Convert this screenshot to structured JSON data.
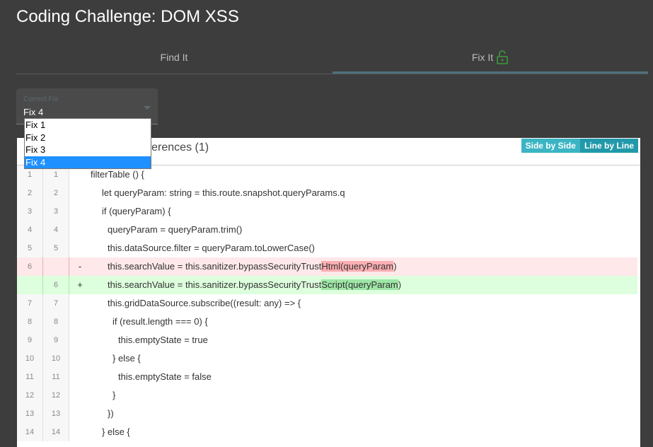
{
  "title": "Coding Challenge: DOM XSS",
  "tabs": [
    {
      "label": "Find It"
    },
    {
      "label": "Fix It"
    }
  ],
  "fix_select": {
    "label": "Correct Fix",
    "value": "Fix 4",
    "options": [
      "Fix 1",
      "Fix 2",
      "Fix 3",
      "Fix 4"
    ]
  },
  "diff": {
    "files_label": "ifferences (1)",
    "view_side_by_side": "Side by Side",
    "view_line_by_line": "Line by Line",
    "rows": [
      {
        "a": "1",
        "b": "1",
        "sign": "",
        "text": "filterTable () {",
        "type": "ctx",
        "indent": 0
      },
      {
        "a": "2",
        "b": "2",
        "sign": "",
        "text": "let queryParam: string = this.route.snapshot.queryParams.q",
        "type": "ctx",
        "indent": 2
      },
      {
        "a": "3",
        "b": "3",
        "sign": "",
        "text": "if (queryParam) {",
        "type": "ctx",
        "indent": 2
      },
      {
        "a": "4",
        "b": "4",
        "sign": "",
        "text": "queryParam = queryParam.trim()",
        "type": "ctx",
        "indent": 3
      },
      {
        "a": "5",
        "b": "5",
        "sign": "",
        "text": "this.dataSource.filter = queryParam.toLowerCase()",
        "type": "ctx",
        "indent": 3
      },
      {
        "a": "6",
        "b": "",
        "sign": "-",
        "pre": "this.searchValue = this.sanitizer.bypassSecurityTrust",
        "hl": "Html(queryParam",
        "post": ")",
        "type": "del",
        "indent": 3
      },
      {
        "a": "",
        "b": "6",
        "sign": "+",
        "pre": "this.searchValue = this.sanitizer.bypassSecurityTrust",
        "hl": "Script(queryParam",
        "post": ")",
        "type": "ins",
        "indent": 3
      },
      {
        "a": "7",
        "b": "7",
        "sign": "",
        "text": "this.gridDataSource.subscribe((result: any) => {",
        "type": "ctx",
        "indent": 3
      },
      {
        "a": "8",
        "b": "8",
        "sign": "",
        "text": "if (result.length === 0) {",
        "type": "ctx",
        "indent": 4
      },
      {
        "a": "9",
        "b": "9",
        "sign": "",
        "text": "this.emptyState = true",
        "type": "ctx",
        "indent": 5
      },
      {
        "a": "10",
        "b": "10",
        "sign": "",
        "text": "} else {",
        "type": "ctx",
        "indent": 4
      },
      {
        "a": "11",
        "b": "11",
        "sign": "",
        "text": "this.emptyState = false",
        "type": "ctx",
        "indent": 5
      },
      {
        "a": "12",
        "b": "12",
        "sign": "",
        "text": "}",
        "type": "ctx",
        "indent": 4
      },
      {
        "a": "13",
        "b": "13",
        "sign": "",
        "text": "})",
        "type": "ctx",
        "indent": 3
      },
      {
        "a": "14",
        "b": "14",
        "sign": "",
        "text": "} else {",
        "type": "ctx",
        "indent": 2
      }
    ]
  },
  "colors": {
    "background": "#3d3d3d",
    "tab_ink": "#4f6f7c",
    "lock_icon": "#3f8f3f",
    "selected_option": "#1e90ff",
    "toggle_active": "#3bb5c4",
    "deleted_bg": "#fee8e9",
    "inserted_bg": "#ddffdd"
  },
  "icons": {
    "fix_tab": "unlock-icon",
    "select": "chevron-down-icon"
  }
}
